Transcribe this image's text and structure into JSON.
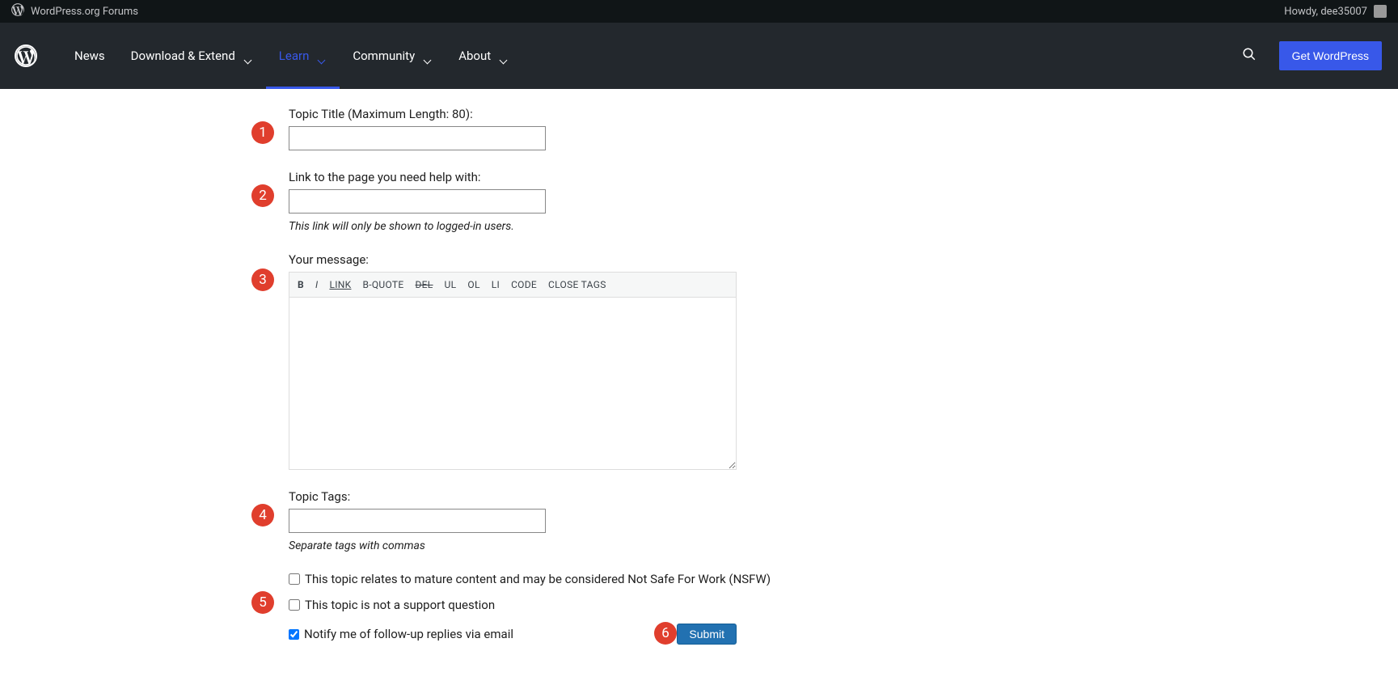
{
  "adminBar": {
    "siteTitle": "WordPress.org Forums",
    "howdy": "Howdy, dee35007"
  },
  "nav": {
    "items": [
      {
        "label": "News",
        "hasDropdown": false
      },
      {
        "label": "Download & Extend",
        "hasDropdown": true
      },
      {
        "label": "Learn",
        "hasDropdown": true,
        "active": true
      },
      {
        "label": "Community",
        "hasDropdown": true
      },
      {
        "label": "About",
        "hasDropdown": true
      }
    ],
    "getWordPress": "Get WordPress"
  },
  "form": {
    "topicTitle": {
      "label": "Topic Title (Maximum Length: 80):",
      "value": ""
    },
    "link": {
      "label": "Link to the page you need help with:",
      "value": "",
      "hint": "This link will only be shown to logged-in users."
    },
    "message": {
      "label": "Your message:",
      "value": "",
      "toolbar": {
        "b": "B",
        "i": "I",
        "link": "LINK",
        "bquote": "B-QUOTE",
        "del": "DEL",
        "ul": "UL",
        "ol": "OL",
        "li": "LI",
        "code": "CODE",
        "close": "CLOSE TAGS"
      }
    },
    "tags": {
      "label": "Topic Tags:",
      "value": "",
      "hint": "Separate tags with commas"
    },
    "nsfw": {
      "label": "This topic relates to mature content and may be considered Not Safe For Work (NSFW)",
      "checked": false
    },
    "notSupport": {
      "label": "This topic is not a support question",
      "checked": false
    },
    "notify": {
      "label": "Notify me of follow-up replies via email",
      "checked": true
    },
    "submit": "Submit"
  },
  "badges": [
    "1",
    "2",
    "3",
    "4",
    "5",
    "6"
  ]
}
